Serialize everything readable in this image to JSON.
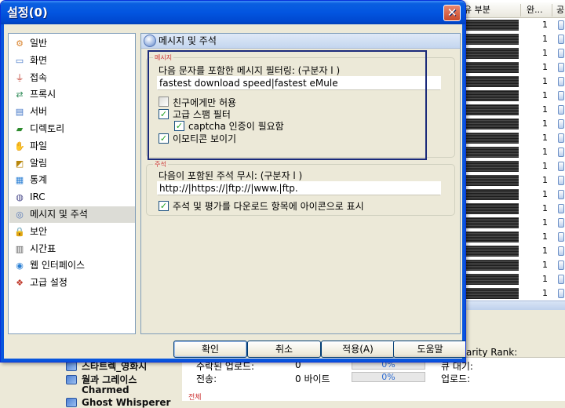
{
  "background": {
    "header": {
      "col1": "유 부분",
      "col2": "완...",
      "col3": "공"
    },
    "row_count_value": "1",
    "tree_items": [
      "스타트렉_영화시",
      "월과 그레이스",
      "Charmed",
      "Ghost Whisperer"
    ],
    "stats": {
      "rarity_label": "arity Rank:",
      "completed_label": "수락된 업로드:",
      "completed_value": "0",
      "completed_pct": "0%",
      "completed_fraction": 0.0,
      "queue_label": "큐 대기:",
      "sent_label": "전송:",
      "sent_value": "0 바이트",
      "sent_pct": "0%",
      "sent_fraction": 0.0,
      "upload_label": "업로드:",
      "total_label": "전체"
    }
  },
  "dialog": {
    "title": "설정(0)",
    "close_glyph": "✕",
    "nav": [
      {
        "label": "일반",
        "icon": "gear-icon",
        "glyph": "⚙",
        "color": "#d9822b"
      },
      {
        "label": "화면",
        "icon": "monitor-icon",
        "glyph": "▭",
        "color": "#3a6fc4"
      },
      {
        "label": "접속",
        "icon": "connection-icon",
        "glyph": "⏚",
        "color": "#c0392b"
      },
      {
        "label": "프록시",
        "icon": "proxy-icon",
        "glyph": "⇄",
        "color": "#2e8b57"
      },
      {
        "label": "서버",
        "icon": "server-icon",
        "glyph": "▤",
        "color": "#3a6fc4"
      },
      {
        "label": "디렉토리",
        "icon": "folder-icon",
        "glyph": "▰",
        "color": "#2e8b2e"
      },
      {
        "label": "파일",
        "icon": "file-icon",
        "glyph": "✋",
        "color": "#8a6d1e"
      },
      {
        "label": "알림",
        "icon": "notification-icon",
        "glyph": "◩",
        "color": "#b8860b"
      },
      {
        "label": "통계",
        "icon": "statistics-icon",
        "glyph": "▦",
        "color": "#2a7fd4"
      },
      {
        "label": "IRC",
        "icon": "irc-icon",
        "glyph": "◍",
        "color": "#4a4a8a"
      },
      {
        "label": "메시지 및 주석",
        "icon": "messages-icon",
        "glyph": "◎",
        "color": "#5779b8"
      },
      {
        "label": "보안",
        "icon": "lock-icon",
        "glyph": "🔒",
        "color": "#c79a1a"
      },
      {
        "label": "시간표",
        "icon": "schedule-icon",
        "glyph": "▥",
        "color": "#555"
      },
      {
        "label": "웹 인터페이스",
        "icon": "web-icon",
        "glyph": "◉",
        "color": "#2a7fd4"
      },
      {
        "label": "고급 설정",
        "icon": "advanced-icon",
        "glyph": "❖",
        "color": "#c0392b"
      }
    ],
    "selected_index": 10,
    "section_header": "메시지 및 주석",
    "messages": {
      "legend": "메시지",
      "filter_label": "다음 문자를 포함한 메시지 필터링: (구분자 l )",
      "filter_value": "fastest download speed|fastest eMule",
      "friends_only_label": "친구에게만 허용",
      "friends_only_checked": false,
      "spam_filter_label": "고급 스팸 필터",
      "spam_filter_checked": true,
      "captcha_label": "captcha 인증이 필요함",
      "captcha_checked": true,
      "emoticons_label": "이모티콘 보이기",
      "emoticons_checked": true
    },
    "comments": {
      "legend": "주석",
      "ignore_label": "다음이 포함된 주석 무시: (구분자 l )",
      "ignore_value": "http://|https://|ftp://|www.|ftp.",
      "show_icon_label": "주석 및 평가를 다운로드 항목에 아이콘으로 표시",
      "show_icon_checked": true
    },
    "buttons": {
      "ok": "확인",
      "cancel": "취소",
      "apply": "적용(A)",
      "help": "도움말"
    }
  }
}
